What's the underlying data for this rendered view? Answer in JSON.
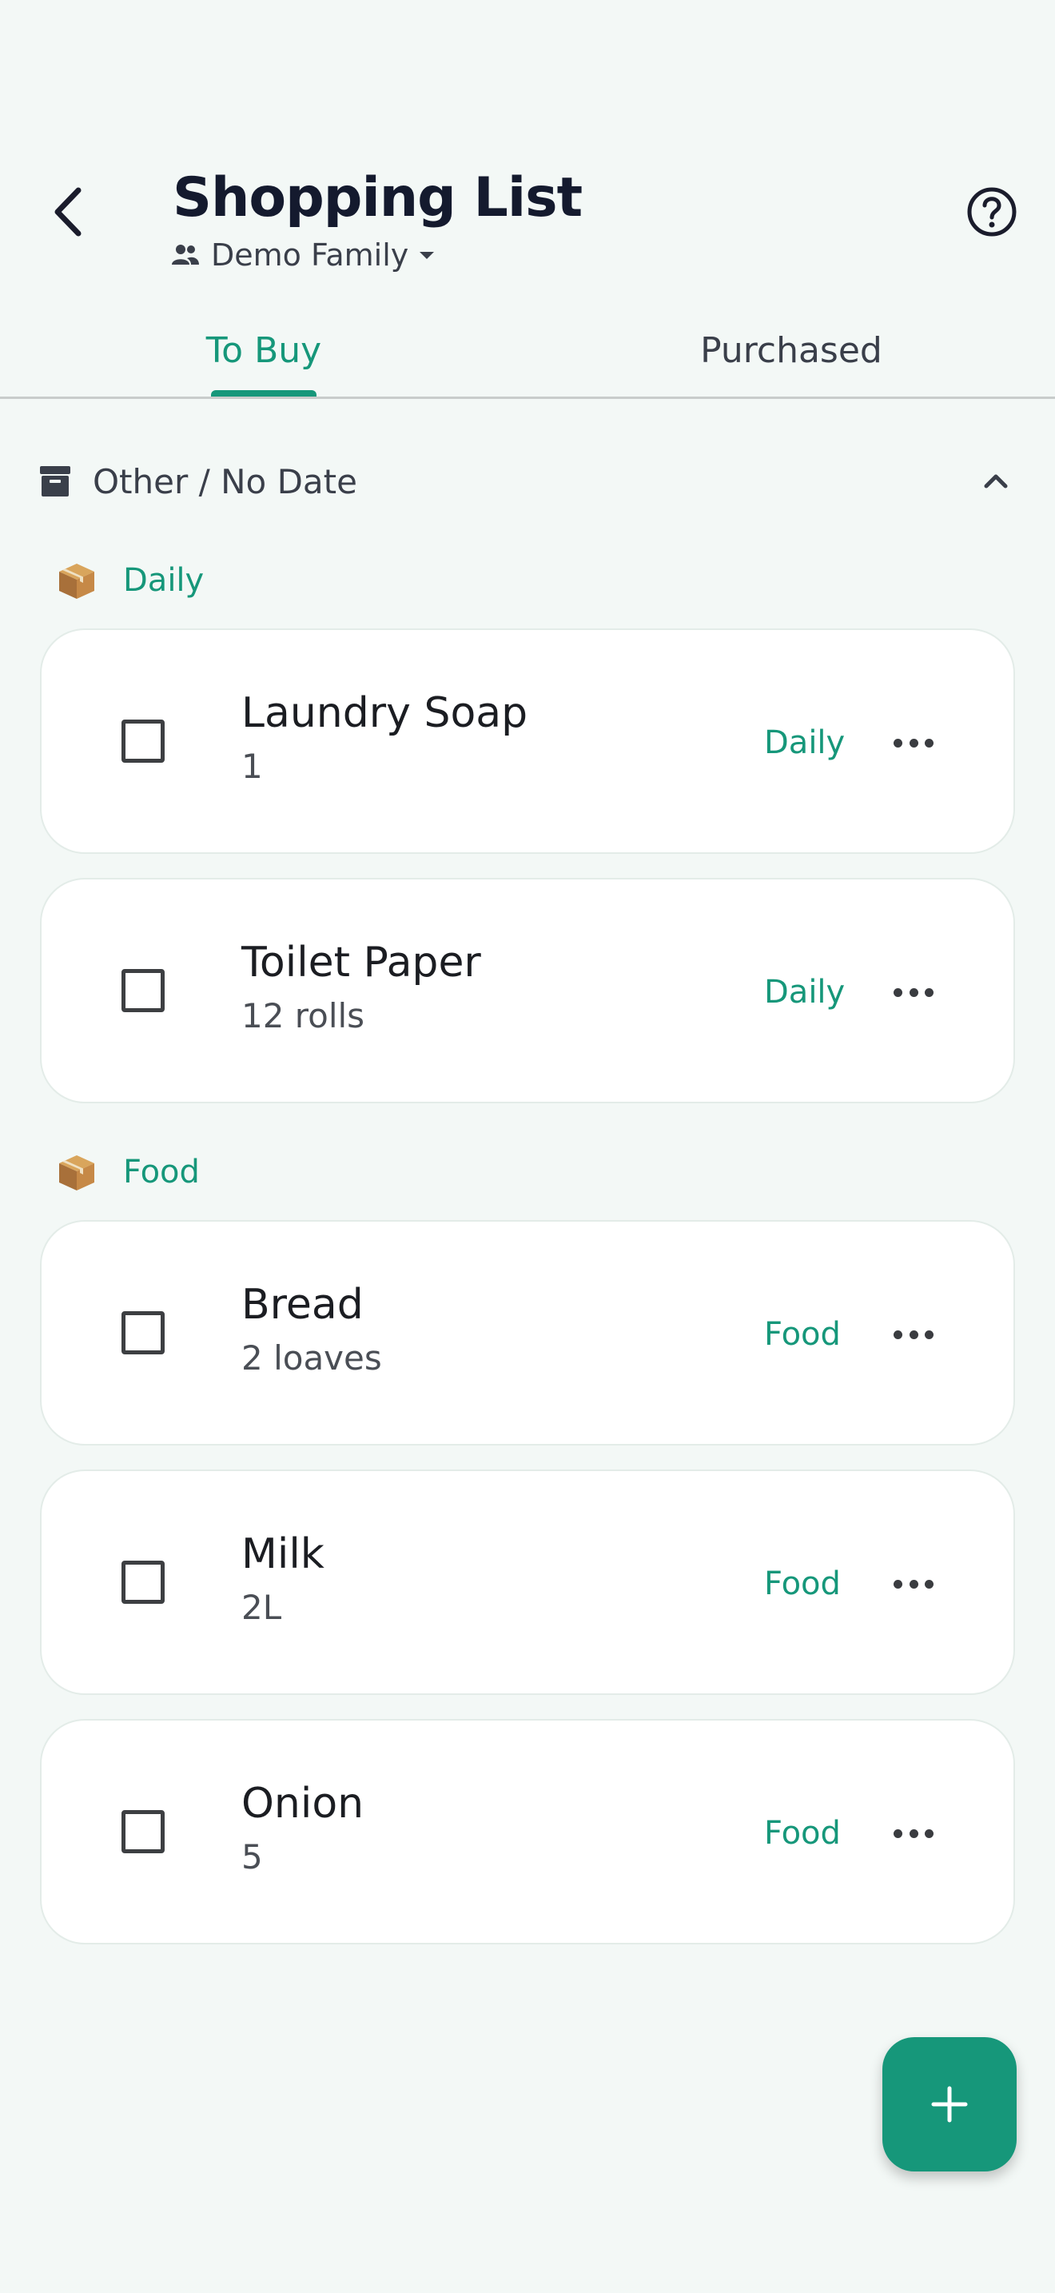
{
  "header": {
    "title": "Shopping List",
    "family": "Demo Family"
  },
  "tabs": [
    {
      "label": "To Buy",
      "active": true
    },
    {
      "label": "Purchased",
      "active": false
    }
  ],
  "section": {
    "label": "Other / No Date",
    "expanded": true
  },
  "categories": [
    {
      "label": "Daily",
      "icon": "package-icon",
      "items": [
        {
          "name": "Laundry Soap",
          "qty": "1",
          "tag": "Daily"
        },
        {
          "name": "Toilet Paper",
          "qty": "12 rolls",
          "tag": "Daily"
        }
      ]
    },
    {
      "label": "Food",
      "icon": "package-icon",
      "items": [
        {
          "name": "Bread",
          "qty": "2 loaves",
          "tag": "Food"
        },
        {
          "name": "Milk",
          "qty": "2L",
          "tag": "Food"
        },
        {
          "name": "Onion",
          "qty": "5",
          "tag": "Food"
        }
      ]
    }
  ],
  "colors": {
    "accent": "#16977a",
    "background": "#f3f8f6",
    "card": "#ffffff",
    "text": "#141a2e"
  }
}
